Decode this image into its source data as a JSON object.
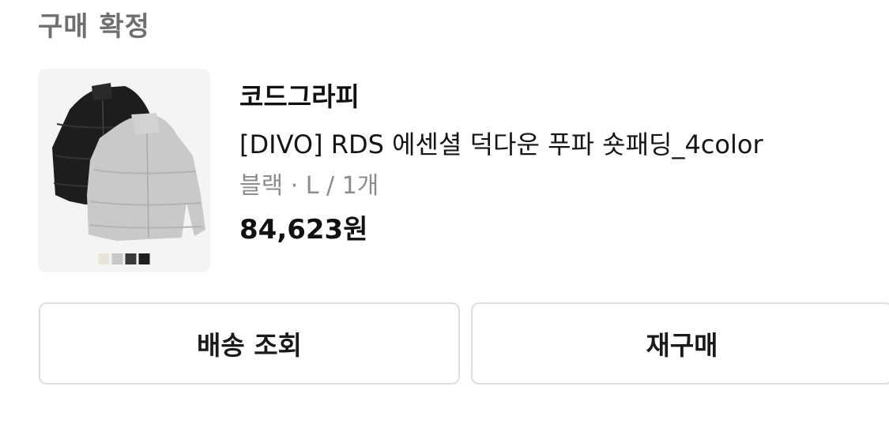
{
  "order": {
    "status_label": "구매 확정"
  },
  "product": {
    "brand": "코드그라피",
    "name": "[DIVO] RDS 에센셜 덕다운 푸파 숏패딩_4color",
    "option": "블랙 · L / 1개",
    "price": "84,623원",
    "image": {
      "icon": "puffer-jacket-thumbnail",
      "swatches": [
        "#e9e4d6",
        "#c7c7c7",
        "#3a3a3a",
        "#1e1e1e"
      ]
    }
  },
  "actions": {
    "track_label": "배송 조회",
    "rebuy_label": "재구매"
  },
  "colors": {
    "status_text": "#6f6f6f",
    "option_text": "#8c8c8c",
    "button_border": "#dedede"
  }
}
